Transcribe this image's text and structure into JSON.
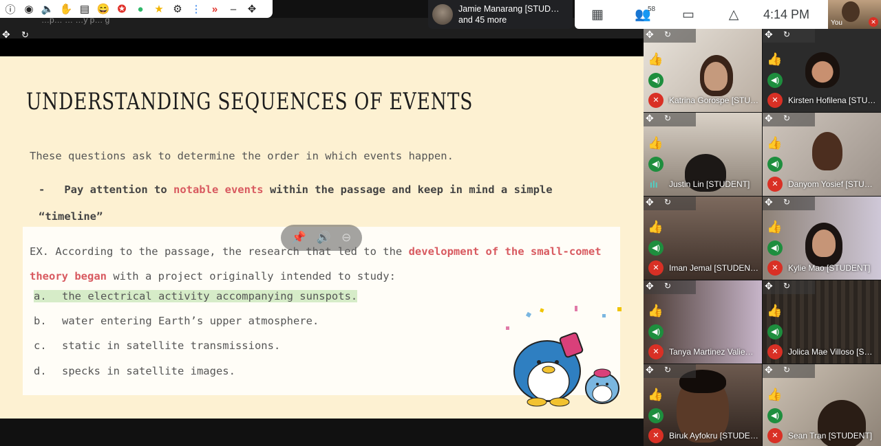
{
  "extensions": [
    "info-icon",
    "eye-icon",
    "speaker-icon",
    "hand-icon",
    "clipboard-icon",
    "emoji-icon",
    "badge-icon",
    "chat-icon",
    "star-icon",
    "gear-icon",
    "more-icon",
    "double-chevron-icon",
    "minimize-icon",
    "move-icon"
  ],
  "presenter_strip_text": "…p… … …y p… g",
  "participants_chip": {
    "line1": "Jamie Manarang [STUD…",
    "line2": "and 45 more"
  },
  "controls": {
    "people_count": "58",
    "time": "4:14 PM"
  },
  "self_view": {
    "label": "You"
  },
  "slide": {
    "title": "UNDERSTANDING SEQUENCES OF EVENTS",
    "intro": "These questions ask to determine the order in which events happen.",
    "bullet_dash": "-",
    "bullet_pre": "Pay attention to ",
    "bullet_hl": "notable events",
    "bullet_post": " within the passage and keep in mind a simple “timeline”",
    "question_pre": "EX. According to the passage, the research that led to the ",
    "question_hl": "development of the small-comet theory began",
    "question_post": " with a project originally intended to study:",
    "options": [
      {
        "letter": "a.",
        "text": "the electrical activity accompanying sunspots."
      },
      {
        "letter": "b.",
        "text": "water entering Earth’s upper atmosphere."
      },
      {
        "letter": "c.",
        "text": "static in satellite transmissions."
      },
      {
        "letter": "d.",
        "text": "specks in satellite images."
      }
    ]
  },
  "tiles": [
    {
      "name": "Katrina Gorospe [STU…",
      "speaking": false
    },
    {
      "name": "Kirsten Hofilena [STU…",
      "speaking": false
    },
    {
      "name": "Justin Lin [STUDENT]",
      "speaking": true
    },
    {
      "name": "Danyom Yosief [STU…",
      "speaking": false
    },
    {
      "name": "Iman Jemal [STUDEN…",
      "speaking": false
    },
    {
      "name": "Kylie Mao [STUDENT]",
      "speaking": false
    },
    {
      "name": "Tanya Martinez Valie…",
      "speaking": false
    },
    {
      "name": "Jolica Mae Villoso [S…",
      "speaking": false
    },
    {
      "name": "Biruk Ayfokru [STUDE…",
      "speaking": false
    },
    {
      "name": "Sean Tran [STUDENT]",
      "speaking": false
    }
  ],
  "colors": {
    "accent": "#d85a60",
    "speaking": "#2ec4b6",
    "mic_on": "#1e8e3e",
    "mic_off": "#d93025"
  }
}
